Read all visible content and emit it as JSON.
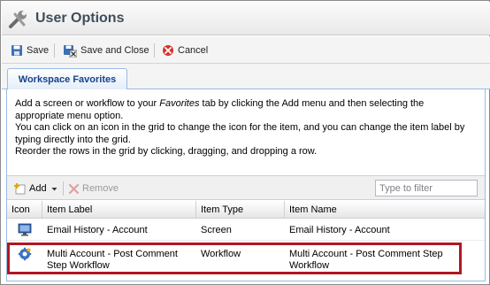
{
  "window": {
    "title": "User Options",
    "icon": "wrench-icon"
  },
  "toolbar": {
    "save_label": "Save",
    "save_close_label": "Save and Close",
    "cancel_label": "Cancel"
  },
  "tabs": [
    {
      "label": "Workspace Favorites",
      "active": true
    }
  ],
  "description": {
    "line1_pre": "Add a screen or workflow to your ",
    "line1_em": "Favorites",
    "line1_post": " tab by clicking the Add menu and then selecting the appropriate menu option.",
    "line2": "You can click on an icon in the grid to change the icon for the item, and you can change the item label by typing directly into the grid.",
    "line3": "Reorder the rows in the grid by clicking, dragging, and dropping a row."
  },
  "grid_toolbar": {
    "add_label": "Add",
    "remove_label": "Remove",
    "filter_placeholder": "Type to filter"
  },
  "grid": {
    "columns": [
      "Icon",
      "Item Label",
      "Item Type",
      "Item Name"
    ],
    "rows": [
      {
        "icon": "monitor-icon",
        "label": "Email History - Account",
        "type": "Screen",
        "name": "Email History - Account"
      },
      {
        "icon": "workflow-gear-icon",
        "label": "Multi Account - Post Comment Step Workflow",
        "type": "Workflow",
        "name": "Multi Account - Post Comment Step Workflow",
        "highlighted": true
      }
    ]
  },
  "colors": {
    "highlight_border": "#b01622",
    "tab_text": "#15428b",
    "title_text": "#3f4d5a"
  }
}
